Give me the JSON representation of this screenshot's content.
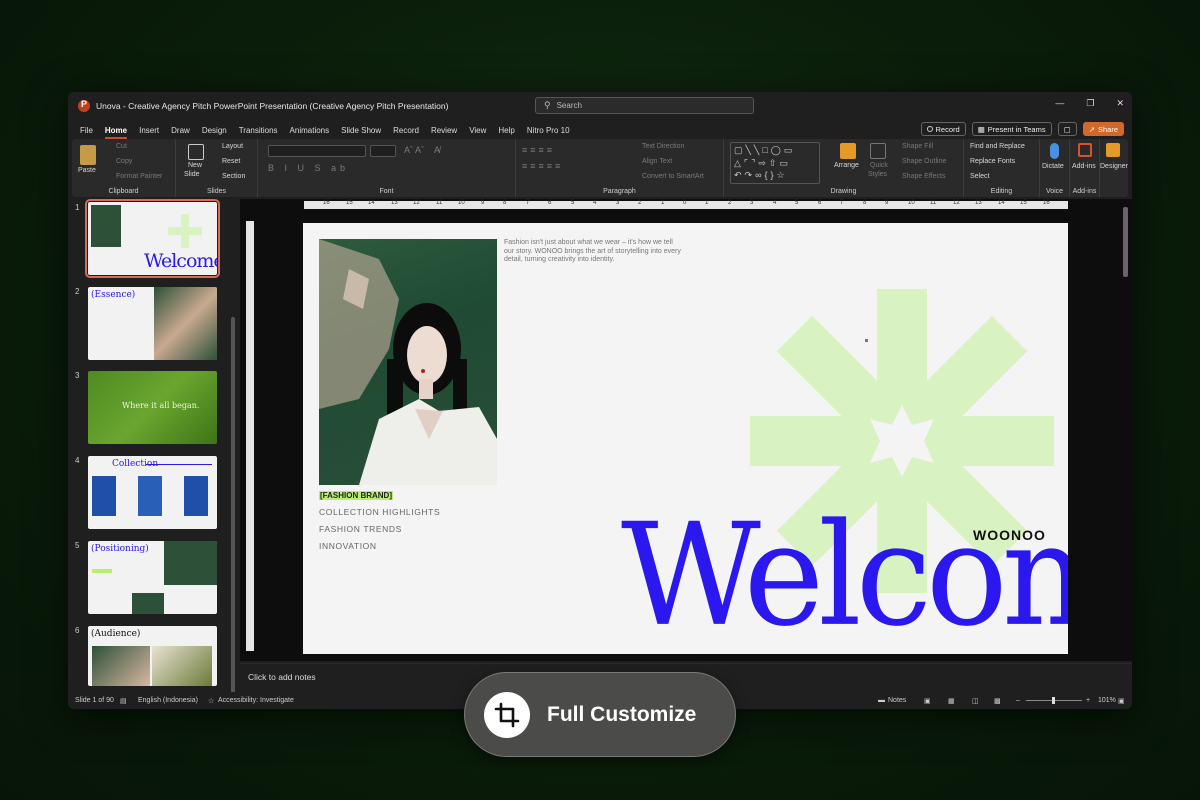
{
  "window": {
    "title": "Unova - Creative Agency Pitch PowerPoint Presentation (Creative Agency Pitch Presentation)",
    "search_placeholder": "Search"
  },
  "menu": {
    "tabs": [
      "File",
      "Home",
      "Insert",
      "Draw",
      "Design",
      "Transitions",
      "Animations",
      "Slide Show",
      "Record",
      "Review",
      "View",
      "Help",
      "Nitro Pro 10"
    ],
    "active": "Home",
    "record_label": "Record",
    "present_label": "Present in Teams",
    "share_label": "Share"
  },
  "ribbon": {
    "clipboard": {
      "label": "Clipboard",
      "paste": "Paste",
      "cut": "Cut",
      "copy": "Copy",
      "format_painter": "Format Painter"
    },
    "slides": {
      "label": "Slides",
      "new_slide_1": "New",
      "new_slide_2": "Slide",
      "layout": "Layout",
      "reset": "Reset",
      "section": "Section"
    },
    "font": {
      "label": "Font"
    },
    "paragraph": {
      "label": "Paragraph",
      "text_direction": "Text Direction",
      "align_text": "Align Text",
      "convert_smartart": "Convert to SmartArt"
    },
    "drawing": {
      "label": "Drawing",
      "arrange": "Arrange",
      "quick_styles_1": "Quick",
      "quick_styles_2": "Styles",
      "shape_fill": "Shape Fill",
      "shape_outline": "Shape Outline",
      "shape_effects": "Shape Effects"
    },
    "editing": {
      "label": "Editing",
      "find_replace": "Find and Replace",
      "replace_fonts": "Replace Fonts",
      "select": "Select"
    },
    "voice": {
      "label": "Voice",
      "dictate": "Dictate"
    },
    "addins": {
      "label": "Add-ins",
      "addins_btn": "Add-ins"
    },
    "designer": {
      "label": "Designer"
    }
  },
  "thumbnails": [
    {
      "num": "1",
      "text": "Welcome"
    },
    {
      "num": "2",
      "text": "(Essence)"
    },
    {
      "num": "3",
      "text": "Where it all began."
    },
    {
      "num": "4",
      "text": "Collection"
    },
    {
      "num": "5",
      "text": "(Positioning)"
    },
    {
      "num": "6",
      "text": "(Audience)"
    }
  ],
  "ruler_marks": [
    "16",
    "15",
    "14",
    "13",
    "12",
    "11",
    "10",
    "9",
    "8",
    "7",
    "6",
    "5",
    "4",
    "3",
    "2",
    "1",
    "0",
    "1",
    "2",
    "3",
    "4",
    "5",
    "6",
    "7",
    "8",
    "9",
    "10",
    "11",
    "12",
    "13",
    "14",
    "15",
    "16"
  ],
  "slide": {
    "paragraph": "Fashion isn't just about what we wear – it's how we tell our story. WONOO brings the art of storytelling into every detail, turning creativity into identity.",
    "brand_tag": "[FASHION BRAND]",
    "links": [
      "COLLECTION HIGHLIGHTS",
      "FASHION TRENDS",
      "INNOVATION"
    ],
    "brand": "WOONOO",
    "headline": "Welcome",
    "colors": {
      "headline": "#2a18ee",
      "asterisk": "#d9f2c2",
      "tag_highlight": "#b9ef6e"
    }
  },
  "notes_placeholder": "Click to add notes",
  "status": {
    "slide_counter": "Slide 1 of 90",
    "language": "English (Indonesia)",
    "accessibility": "Accessibility: Investigate",
    "notes": "Notes",
    "zoom": "101%"
  },
  "overlay": {
    "label": "Full Customize",
    "icon": "crop-icon"
  }
}
